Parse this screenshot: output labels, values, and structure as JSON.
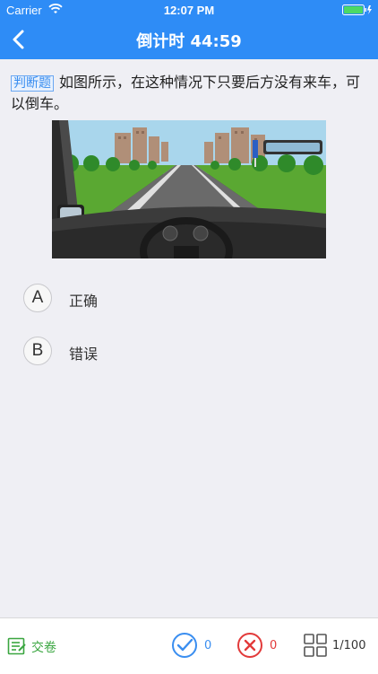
{
  "status_bar": {
    "carrier": "Carrier",
    "time": "12:07 PM"
  },
  "nav": {
    "title": "倒计时 44:59"
  },
  "question": {
    "type_tag": "判断题",
    "text": "如图所示，在这种情况下只要后方没有来车，可以倒车。"
  },
  "options": [
    {
      "letter": "A",
      "text": "正确"
    },
    {
      "letter": "B",
      "text": "错误"
    }
  ],
  "bottom": {
    "submit_label": "交卷",
    "correct_count": "0",
    "wrong_count": "0",
    "progress": "1/100"
  },
  "colors": {
    "primary": "#2e8cf6",
    "correct": "#3a8ef0",
    "wrong": "#e23a3a",
    "submit": "#3aa640"
  }
}
